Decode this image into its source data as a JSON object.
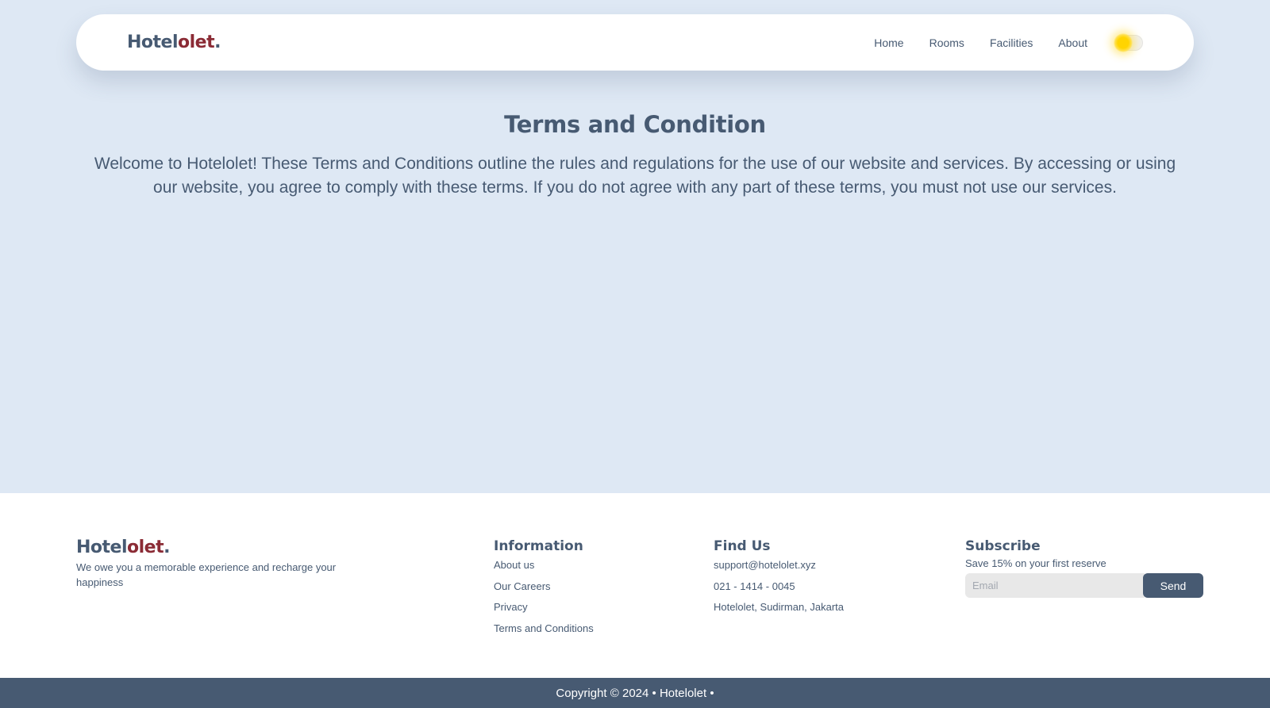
{
  "navbar": {
    "brand": {
      "part1": "Hotel",
      "part2": "olet",
      "part3": "."
    },
    "links": [
      "Home",
      "Rooms",
      "Facilities",
      "About"
    ],
    "theme_toggle_icon": "sun-icon"
  },
  "main": {
    "title": "Terms and Condition",
    "intro": "Welcome to Hotelolet! These Terms and Conditions outline the rules and regulations for the use of our website and services. By accessing or using our website, you agree to comply with these terms. If you do not agree with any part of these terms, you must not use our services."
  },
  "footer": {
    "brand": {
      "part1": "Hotel",
      "part2": "olet",
      "part3": "."
    },
    "tagline": "We owe you a memorable experience and recharge your happiness",
    "information": {
      "heading": "Information",
      "links": [
        "About us",
        "Our Careers",
        "Privacy",
        "Terms and Conditions"
      ]
    },
    "find_us": {
      "heading": "Find Us",
      "items": [
        "support@hotelolet.xyz",
        "021 - 1414 - 0045",
        "Hotelolet, Sudirman, Jakarta"
      ]
    },
    "subscribe": {
      "heading": "Subscribe",
      "text": "Save 15% on your first reserve",
      "placeholder": "Email",
      "button": "Send"
    },
    "copyright": "Copyright © 2024 • Hotelolet •"
  },
  "colors": {
    "background": "#dee8f4",
    "primary": "#475a72",
    "brand_accent": "#8b2b35",
    "toggle_sun": "#ffd400"
  }
}
